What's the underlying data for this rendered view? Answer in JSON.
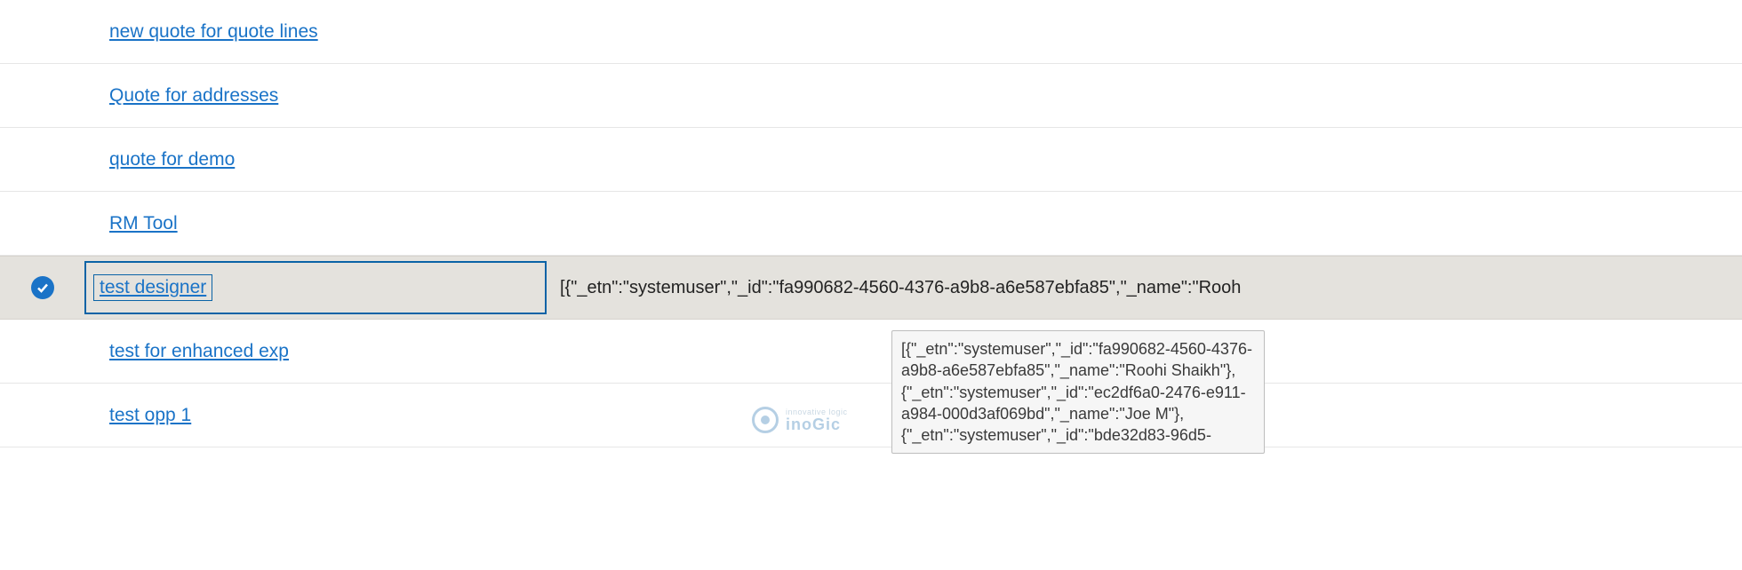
{
  "colors": {
    "link": "#1a73c7",
    "selection_bg": "#e4e2dd",
    "focus_border": "#0a63a6"
  },
  "rows": [
    {
      "name": "new quote for quote lines",
      "value": "",
      "selected": false,
      "focused": false
    },
    {
      "name": "Quote for addresses",
      "value": "",
      "selected": false,
      "focused": false
    },
    {
      "name": "quote for demo",
      "value": "",
      "selected": false,
      "focused": false
    },
    {
      "name": "RM Tool",
      "value": "",
      "selected": false,
      "focused": false
    },
    {
      "name": "test designer",
      "value": "[{\"_etn\":\"systemuser\",\"_id\":\"fa990682-4560-4376-a9b8-a6e587ebfa85\",\"_name\":\"Rooh",
      "selected": true,
      "focused": true
    },
    {
      "name": "test for enhanced exp",
      "value": "",
      "selected": false,
      "focused": false
    },
    {
      "name": "test opp 1",
      "value": "",
      "selected": false,
      "focused": false
    }
  ],
  "tooltip": {
    "line1": "[{\"_etn\":\"systemuser\",\"_id\":\"fa990682-4560-4376-a9b8-a6e587ebfa85\",\"_name\":\"Roohi Shaikh\"},",
    "line2": "{\"_etn\":\"systemuser\",\"_id\":\"ec2df6a0-2476-e911-a984-000d3af069bd\",\"_name\":\"Joe M\"},",
    "line3": "{\"_etn\":\"systemuser\",\"_id\":\"bde32d83-96d5-"
  },
  "watermark": {
    "sub": "innovative logic",
    "main": "inoGic"
  }
}
